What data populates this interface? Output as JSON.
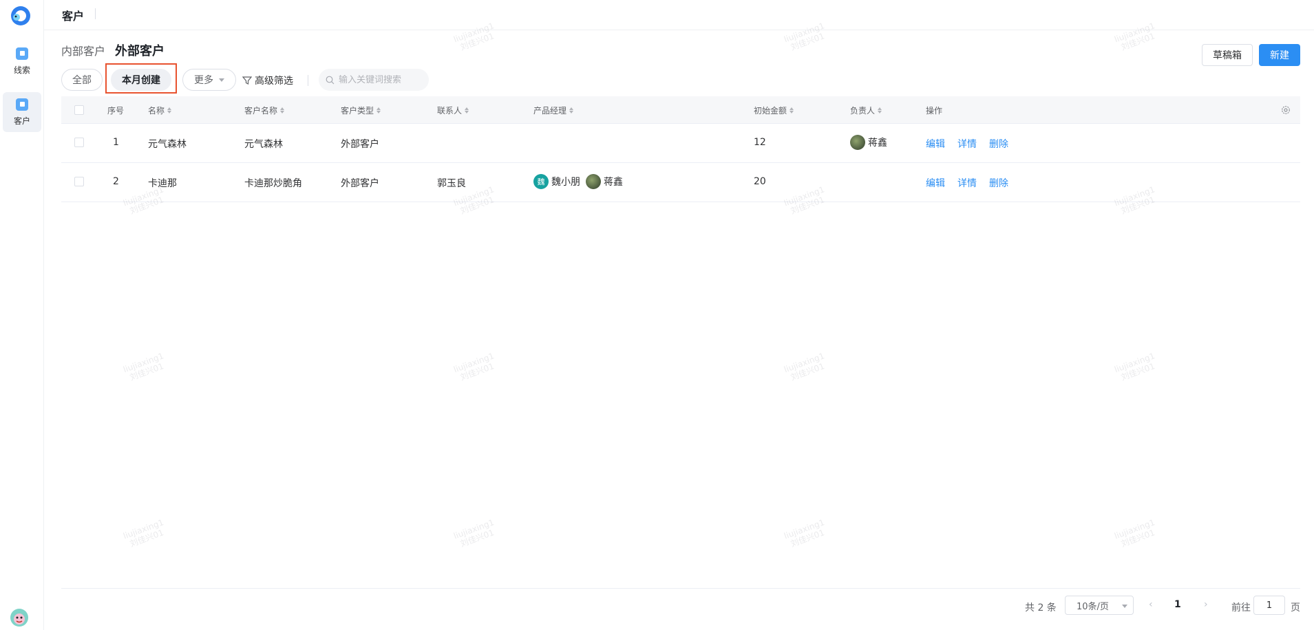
{
  "nav": {
    "items": [
      {
        "label": "线索",
        "icon": "clue-icon"
      },
      {
        "label": "客户",
        "icon": "customer-icon"
      }
    ]
  },
  "header": {
    "title": "客户"
  },
  "subtabs": {
    "internal": "内部客户",
    "external": "外部客户"
  },
  "toolbar": {
    "draft_label": "草稿箱",
    "new_label": "新建"
  },
  "filters": {
    "all": "全部",
    "this_month": "本月创建",
    "more": "更多",
    "advanced": "高级筛选",
    "search_placeholder": "输入关键词搜索"
  },
  "table": {
    "headers": {
      "index": "序号",
      "name": "名称",
      "customer_name": "客户名称",
      "customer_type": "客户类型",
      "contact": "联系人",
      "product_manager": "产品经理",
      "initial_amount": "初始金额",
      "owner": "负责人",
      "actions": "操作"
    },
    "rows": [
      {
        "index": "1",
        "name": "元气森林",
        "customer_name": "元气森林",
        "customer_type": "外部客户",
        "contact": "",
        "pm1_avatar": "",
        "pm1_name": "",
        "pm2_name": "",
        "initial_amount": "12",
        "owner": "蒋鑫",
        "edit": "编辑",
        "detail": "详情",
        "delete": "删除"
      },
      {
        "index": "2",
        "name": "卡迪那",
        "customer_name": "卡迪那炒脆角",
        "customer_type": "外部客户",
        "contact": "郭玉良",
        "pm1_avatar": "魏",
        "pm1_name": "魏小朋",
        "pm2_name": "蒋鑫",
        "initial_amount": "20",
        "owner": "",
        "edit": "编辑",
        "detail": "详情",
        "delete": "删除"
      }
    ]
  },
  "pagination": {
    "total": "共 2 条",
    "page_size": "10条/页",
    "current_page": "1",
    "goto_label": "前往",
    "goto_value": "1",
    "page_unit": "页"
  },
  "watermark": {
    "line1": "liujiaxing1",
    "line2": "刘佳兴01"
  },
  "colors": {
    "primary": "#2b8ef3",
    "highlight": "#e8522e",
    "rail_icon": "#5aa9f7"
  }
}
